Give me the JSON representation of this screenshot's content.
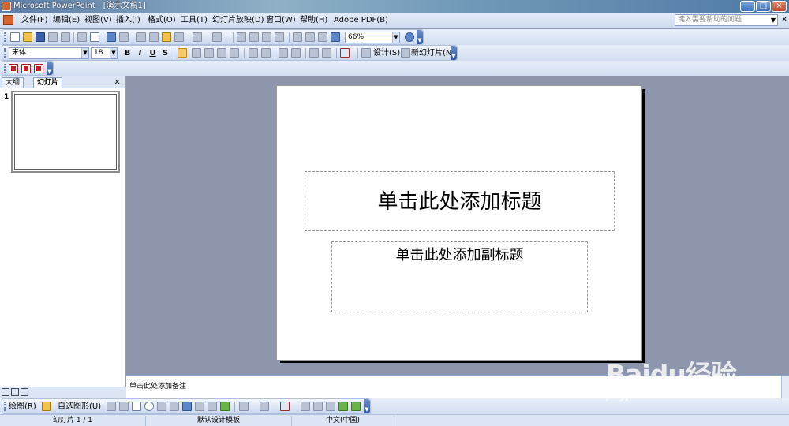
{
  "window": {
    "title": "Microsoft PowerPoint - [演示文稿1]",
    "buttons": [
      "_",
      "□",
      "×"
    ]
  },
  "menu": {
    "items": [
      "文件(F)",
      "编辑(E)",
      "视图(V)",
      "插入(I)",
      "格式(O)",
      "工具(T)",
      "幻灯片放映(D)",
      "窗口(W)",
      "帮助(H)",
      "Adobe PDF(B)"
    ],
    "help_placeholder": "键入需要帮助的问题",
    "close": "×"
  },
  "standard_toolbar": {
    "zoom": "66%"
  },
  "formatting_toolbar": {
    "font": "宋体",
    "font_size": "18",
    "bold": "B",
    "italic": "I",
    "underline": "U",
    "shadow": "S",
    "design_label": "设计(S)",
    "new_slide_label": "新幻灯片(N)"
  },
  "left_panel": {
    "tabs": [
      "大纲",
      "幻灯片"
    ],
    "close": "×",
    "slide_number": "1"
  },
  "slide": {
    "title_placeholder": "单击此处添加标题",
    "subtitle_placeholder": "单击此处添加副标题"
  },
  "notes": {
    "placeholder": "单击此处添加备注"
  },
  "drawing_toolbar": {
    "draw_label": "绘图(R)",
    "autoshapes_label": "自选图形(U)"
  },
  "status": {
    "slide_info": "幻灯片 1 / 1",
    "template": "默认设计模板",
    "language": "中文(中国)"
  },
  "watermark": {
    "brand": "Baidu经验",
    "url": "jingyan.baidu.com"
  }
}
